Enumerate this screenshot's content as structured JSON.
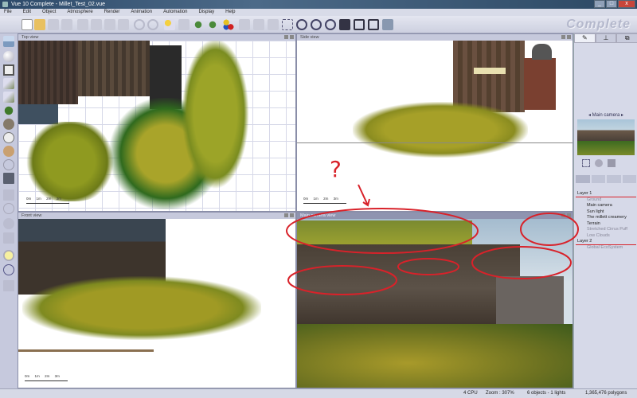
{
  "window": {
    "title": "Vue 10 Complete - Millet_Test_02.vue",
    "minimize": "_",
    "maximize": "□",
    "close": "x"
  },
  "menu": [
    "File",
    "Edit",
    "Object",
    "Atmosphere",
    "Render",
    "Animation",
    "Automation",
    "Display",
    "Help"
  ],
  "watermark": "Complete",
  "viewports": {
    "top": {
      "title": "Top view",
      "scale": [
        "0m",
        "1m",
        "2m",
        "3m"
      ]
    },
    "side": {
      "title": "Side view",
      "scale": [
        "0m",
        "1m",
        "2m",
        "3m"
      ]
    },
    "front": {
      "title": "Front view",
      "scale": [
        "0m",
        "1m",
        "2m",
        "3m"
      ]
    },
    "camera": {
      "title": "Main camera view"
    }
  },
  "right_panel": {
    "preview_title": "Main camera",
    "tree": [
      {
        "label": "Layer 1",
        "level": 0
      },
      {
        "label": "Ground",
        "level": 1,
        "dim": true
      },
      {
        "label": "Main camera",
        "level": 1
      },
      {
        "label": "Sun light",
        "level": 1
      },
      {
        "label": "The millett creamery",
        "level": 1
      },
      {
        "label": "Terrain",
        "level": 1
      },
      {
        "label": "Stretched Cirrus Puff",
        "level": 1,
        "dim": true
      },
      {
        "label": "Low Clouds",
        "level": 1,
        "dim": true
      },
      {
        "label": "Layer 2",
        "level": 0
      },
      {
        "label": "Global EcoSystem",
        "level": 1,
        "dim": true
      }
    ]
  },
  "annotation": {
    "question_mark": "?",
    "color": "#d8222a"
  },
  "status": {
    "cpu": "4 CPU",
    "zoom": "Zoom : 307%",
    "objects": "6 objects - 1 lights",
    "polygons": "1,365,476 polygons"
  }
}
